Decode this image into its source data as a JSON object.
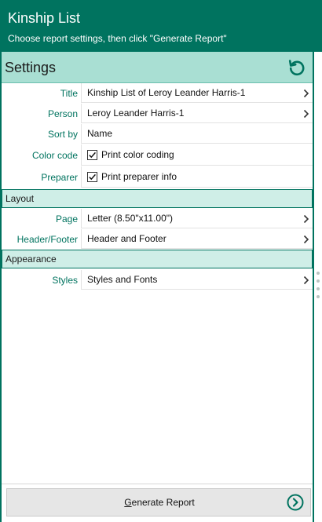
{
  "header": {
    "title": "Kinship List",
    "subtitle": "Choose report settings, then click \"Generate Report\""
  },
  "settings": {
    "title": "Settings",
    "reset_icon": "reset-icon",
    "rows": {
      "title": {
        "label": "Title",
        "value": "Kinship List of Leroy Leander Harris-1"
      },
      "person": {
        "label": "Person",
        "value": "Leroy Leander Harris-1"
      },
      "sort_by": {
        "label": "Sort by",
        "value": "Name"
      },
      "color_code": {
        "label": "Color code",
        "value": "Print color coding",
        "checked": true
      },
      "preparer": {
        "label": "Preparer",
        "value": "Print preparer info",
        "checked": true
      }
    }
  },
  "layout": {
    "section_label": "Layout",
    "page": {
      "label": "Page",
      "value": "Letter (8.50\"x11.00\")"
    },
    "header_footer": {
      "label": "Header/Footer",
      "value": "Header and Footer"
    }
  },
  "appearance": {
    "section_label": "Appearance",
    "styles": {
      "label": "Styles",
      "value": "Styles and Fonts"
    }
  },
  "footer": {
    "generate_mnemonic": "G",
    "generate_rest": "enerate Report",
    "go_icon": "arrow-circle-right-icon"
  },
  "colors": {
    "header_bg": "#00735f",
    "settings_bar_bg": "#a9dfd3",
    "section_bg": "#cfeee7",
    "label_color": "#00735f",
    "button_bg": "#e6e6e6"
  }
}
